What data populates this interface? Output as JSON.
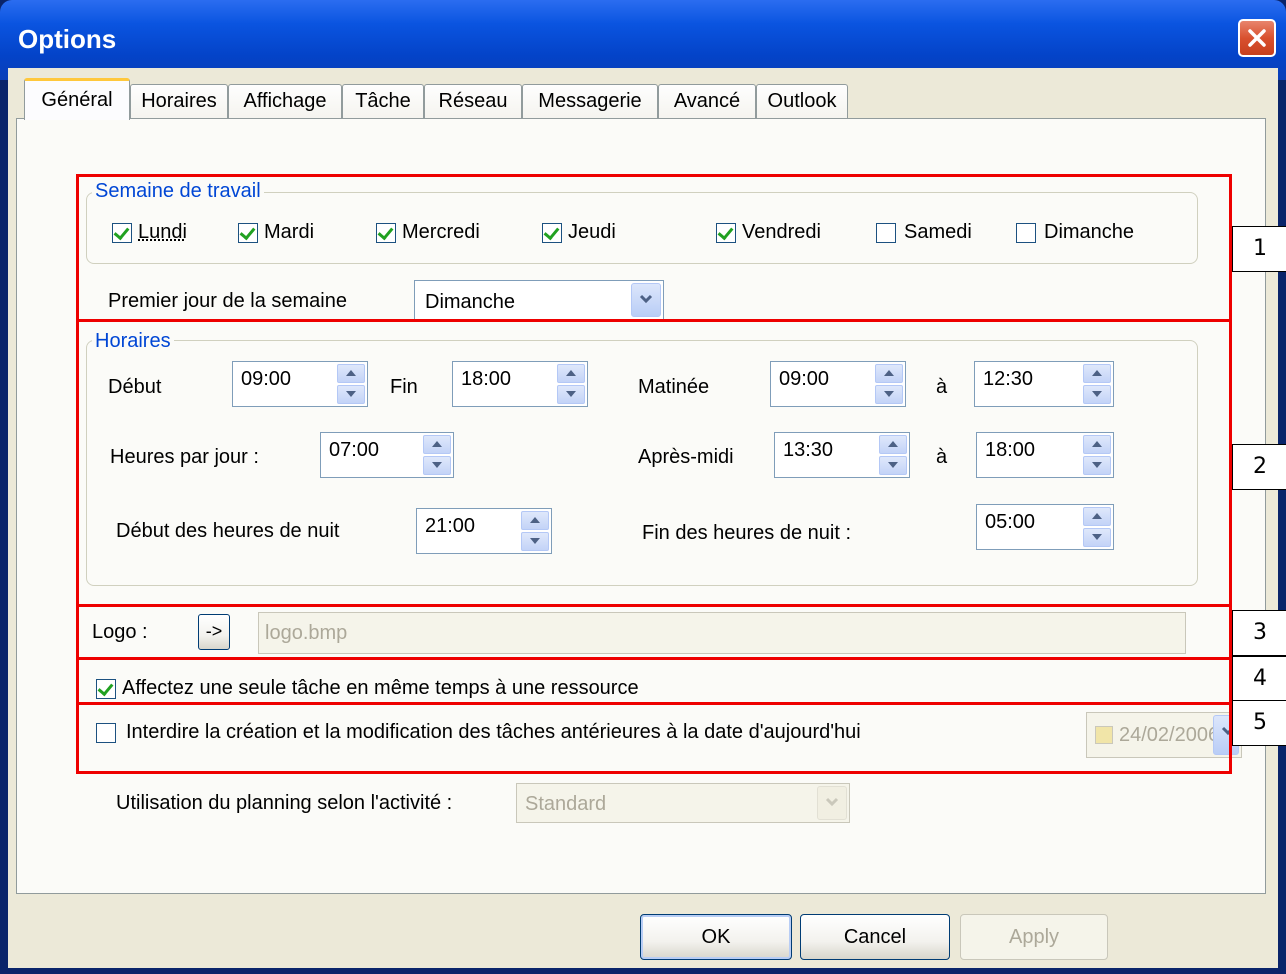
{
  "window": {
    "title": "Options"
  },
  "tabs": [
    "Général",
    "Horaires",
    "Affichage",
    "Tâche",
    "Réseau",
    "Messagerie",
    "Avancé",
    "Outlook"
  ],
  "work_week": {
    "title": "Semaine de travail",
    "days": [
      {
        "label": "Lundi",
        "checked": true
      },
      {
        "label": "Mardi",
        "checked": true
      },
      {
        "label": "Mercredi",
        "checked": true
      },
      {
        "label": "Jeudi",
        "checked": true
      },
      {
        "label": "Vendredi",
        "checked": true
      },
      {
        "label": "Samedi",
        "checked": false
      },
      {
        "label": "Dimanche",
        "checked": false
      }
    ],
    "first_day_label": "Premier jour de la semaine",
    "first_day_value": "Dimanche"
  },
  "schedule": {
    "title": "Horaires",
    "start_label": "Début",
    "start_value": "09:00",
    "end_label": "Fin",
    "end_value": "18:00",
    "morning_label": "Matinée",
    "morning_from": "09:00",
    "to_label": "à",
    "morning_to": "12:30",
    "hours_per_day_label": "Heures par jour :",
    "hours_per_day_value": "07:00",
    "afternoon_label": "Après-midi",
    "afternoon_from": "13:30",
    "afternoon_to": "18:00",
    "night_start_label": "Début des heures de nuit",
    "night_start_value": "21:00",
    "night_end_label": "Fin des heures de nuit :",
    "night_end_value": "05:00"
  },
  "logo": {
    "label": "Logo :",
    "button_label": "->",
    "value": "logo.bmp"
  },
  "single_task": {
    "label": "Affectez une seule tâche en même temps à une ressource",
    "checked": true
  },
  "forbid_past": {
    "label": "Interdire la création et la modification des tâches antérieures à la date d'aujourd'hui",
    "checked": false,
    "date": "24/02/2006"
  },
  "activity": {
    "label": "Utilisation du planning selon l'activité :",
    "value": "Standard"
  },
  "buttons": {
    "ok": "OK",
    "cancel": "Cancel",
    "apply": "Apply"
  },
  "annotations": [
    "1",
    "2",
    "3",
    "4",
    "5"
  ],
  "colors": {
    "title_bar": "#0a54e0",
    "group_title": "#0046d5",
    "annotation_box": "#ee0000",
    "dialog_bg": "#ece9d8"
  }
}
